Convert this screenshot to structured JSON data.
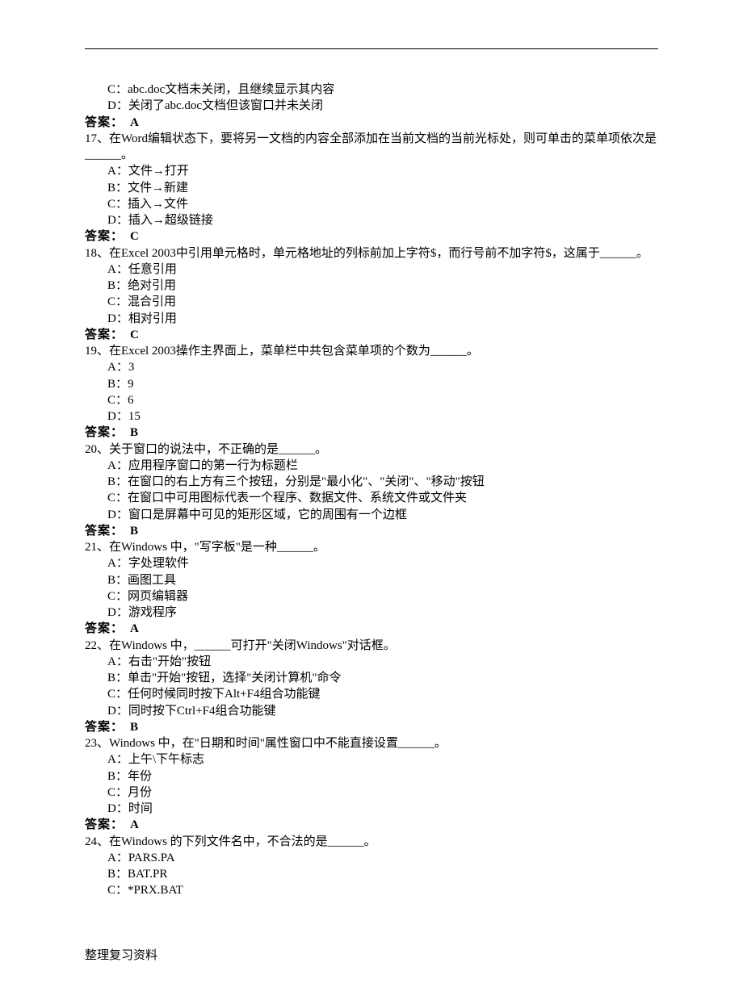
{
  "preOptions": [
    "C：abc.doc文档未关闭，且继续显示其内容",
    "D：关闭了abc.doc文档但该窗口并未关闭"
  ],
  "preAnswerLabel": "答案：",
  "preAnswerLetter": "A",
  "questions": [
    {
      "num": "17、",
      "text": "在Word编辑状态下，要将另一文档的内容全部添加在当前文档的当前光标处，则可单击的菜单项依次是______。",
      "options": [
        "A：文件→打开",
        "B：文件→新建",
        "C：插入→文件",
        "D：插入→超级链接"
      ],
      "answerLabel": "答案：",
      "answerLetter": "C"
    },
    {
      "num": "18、",
      "text": "在Excel 2003中引用单元格时，单元格地址的列标前加上字符$，而行号前不加字符$，这属于______。",
      "options": [
        "A：任意引用",
        "B：绝对引用",
        "C：混合引用",
        "D：相对引用"
      ],
      "answerLabel": "答案：",
      "answerLetter": "C"
    },
    {
      "num": "19、",
      "text": "在Excel 2003操作主界面上，菜单栏中共包含菜单项的个数为______。",
      "options": [
        "A：3",
        "B：9",
        "C：6",
        "D：15"
      ],
      "answerLabel": "答案：",
      "answerLetter": "B"
    },
    {
      "num": "20、",
      "text": "关于窗口的说法中，不正确的是______。",
      "options": [
        "A：应用程序窗口的第一行为标题栏",
        "B：在窗口的右上方有三个按钮，分别是\"最小化\"、\"关闭\"、\"移动\"按钮",
        "C：在窗口中可用图标代表一个程序、数据文件、系统文件或文件夹",
        "D：窗口是屏幕中可见的矩形区域，它的周围有一个边框"
      ],
      "answerLabel": "答案：",
      "answerLetter": "B"
    },
    {
      "num": "21、",
      "text": "在Windows 中，\"写字板\"是一种______。",
      "options": [
        "A：字处理软件",
        "B：画图工具",
        "C：网页编辑器",
        "D：游戏程序"
      ],
      "answerLabel": "答案：",
      "answerLetter": "A"
    },
    {
      "num": "22、",
      "text": "在Windows 中，______可打开\"关闭Windows\"对话框。",
      "options": [
        "A：右击\"开始\"按钮",
        "B：单击\"开始\"按钮，选择\"关闭计算机\"命令",
        "C：任何时候同时按下Alt+F4组合功能键",
        "D：同时按下Ctrl+F4组合功能键"
      ],
      "answerLabel": "答案：",
      "answerLetter": "B"
    },
    {
      "num": "23、",
      "text": "Windows 中，在\"日期和时间\"属性窗口中不能直接设置______。",
      "options": [
        "A：上午\\下午标志",
        "B：年份",
        "C：月份",
        "D：时间"
      ],
      "answerLabel": "答案：",
      "answerLetter": "A"
    },
    {
      "num": "24、",
      "text": "在Windows 的下列文件名中，不合法的是______。",
      "options": [
        "A：PARS.PA",
        "B：BAT.PR",
        "C：*PRX.BAT"
      ],
      "answerLabel": null,
      "answerLetter": null
    }
  ],
  "footer": "整理复习资料"
}
